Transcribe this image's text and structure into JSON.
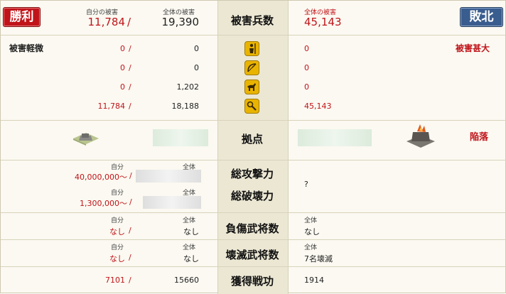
{
  "header": {
    "victory_label": "勝利",
    "defeat_label": "敗北",
    "own_damage_label": "自分の被害",
    "total_damage_label": "全体の被害",
    "title": "被害兵数",
    "own_damage": "11,784",
    "total_damage": "19,390",
    "enemy_total_label": "全体の被害",
    "enemy_damage": "45,143"
  },
  "damage": {
    "left_status": "被害軽微",
    "right_status": "被害甚大",
    "rows": [
      {
        "own": "0",
        "total": "0",
        "enemy": "0",
        "icon": "spearman-icon"
      },
      {
        "own": "0",
        "total": "0",
        "enemy": "0",
        "icon": "archer-icon"
      },
      {
        "own": "0",
        "total": "1,202",
        "enemy": "0",
        "icon": "cavalry-icon"
      },
      {
        "own": "11,784",
        "total": "18,188",
        "enemy": "45,143",
        "icon": "siege-icon"
      }
    ]
  },
  "base": {
    "label": "拠点",
    "fallen": "陥落"
  },
  "attack": {
    "attack_label": "総攻撃力",
    "destroy_label": "総破壊力",
    "own_label": "自分",
    "total_label": "全体",
    "own_attack": "40,000,000～",
    "own_destroy": "1,300,000～",
    "enemy_value": "?"
  },
  "wounded": {
    "label": "負傷武将数",
    "own_label": "自分",
    "total_label": "全体",
    "own": "なし",
    "total": "なし",
    "enemy_label": "全体",
    "enemy": "なし"
  },
  "annihilated": {
    "label": "壊滅武将数",
    "own_label": "自分",
    "total_label": "全体",
    "own": "なし",
    "total": "なし",
    "enemy_label": "全体",
    "enemy": "7名壊滅"
  },
  "merit": {
    "label": "獲得戦功",
    "own": "7101",
    "total": "15660",
    "enemy": "1914"
  },
  "slash": "/",
  "colors": {
    "victory": "#c0141a",
    "defeat": "#3a5d8f",
    "accent_red": "#c0141a",
    "icon_gold": "#e9b400"
  }
}
